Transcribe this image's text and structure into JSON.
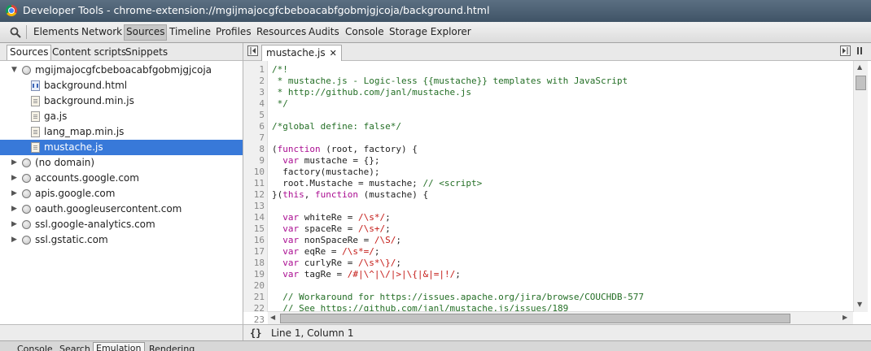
{
  "window": {
    "title": "Developer Tools - chrome-extension://mgijmajocgfcbeboacabfgobmjgjcoja/background.html"
  },
  "toolbar": {
    "tabs": [
      "Elements",
      "Network",
      "Sources",
      "Timeline",
      "Profiles",
      "Resources",
      "Audits",
      "Console",
      "Storage Explorer"
    ],
    "active": "Sources"
  },
  "navigator": {
    "tabs": [
      "Sources",
      "Content scripts",
      "Snippets"
    ],
    "tree": [
      {
        "label": "mgijmajocgfcbeboacabfgobmjgjcoja",
        "type": "origin",
        "expanded": true
      },
      {
        "label": "background.html",
        "type": "html"
      },
      {
        "label": "background.min.js",
        "type": "js"
      },
      {
        "label": "ga.js",
        "type": "js"
      },
      {
        "label": "lang_map.min.js",
        "type": "js"
      },
      {
        "label": "mustache.js",
        "type": "js",
        "selected": true
      },
      {
        "label": "(no domain)",
        "type": "origin"
      },
      {
        "label": "accounts.google.com",
        "type": "origin"
      },
      {
        "label": "apis.google.com",
        "type": "origin"
      },
      {
        "label": "oauth.googleusercontent.com",
        "type": "origin"
      },
      {
        "label": "ssl.google-analytics.com",
        "type": "origin"
      },
      {
        "label": "ssl.gstatic.com",
        "type": "origin"
      }
    ]
  },
  "editor": {
    "file_tab": "mustache.js",
    "close": "✕",
    "lines": [
      [
        {
          "t": "/*!",
          "c": "comment"
        }
      ],
      [
        {
          "t": " * mustache.js - Logic-less {{mustache}} templates with JavaScript",
          "c": "comment"
        }
      ],
      [
        {
          "t": " * http://github.com/janl/mustache.js",
          "c": "comment"
        }
      ],
      [
        {
          "t": " */",
          "c": "comment"
        }
      ],
      [],
      [
        {
          "t": "/*global define: false*/",
          "c": "comment"
        }
      ],
      [],
      [
        {
          "t": "(",
          "c": "plain"
        },
        {
          "t": "function",
          "c": "keyword"
        },
        {
          "t": " (root, factory) {",
          "c": "plain"
        }
      ],
      [
        {
          "t": "  ",
          "c": "plain"
        },
        {
          "t": "var",
          "c": "keyword"
        },
        {
          "t": " mustache = {};",
          "c": "plain"
        }
      ],
      [
        {
          "t": "  factory(mustache);",
          "c": "plain"
        }
      ],
      [
        {
          "t": "  root.Mustache = mustache; ",
          "c": "plain"
        },
        {
          "t": "// <script>",
          "c": "comment"
        }
      ],
      [
        {
          "t": "}(",
          "c": "plain"
        },
        {
          "t": "this",
          "c": "keyword"
        },
        {
          "t": ", ",
          "c": "plain"
        },
        {
          "t": "function",
          "c": "keyword"
        },
        {
          "t": " (mustache) {",
          "c": "plain"
        }
      ],
      [],
      [
        {
          "t": "  ",
          "c": "plain"
        },
        {
          "t": "var",
          "c": "keyword"
        },
        {
          "t": " whiteRe = ",
          "c": "plain"
        },
        {
          "t": "/\\s*/",
          "c": "regex"
        },
        {
          "t": ";",
          "c": "plain"
        }
      ],
      [
        {
          "t": "  ",
          "c": "plain"
        },
        {
          "t": "var",
          "c": "keyword"
        },
        {
          "t": " spaceRe = ",
          "c": "plain"
        },
        {
          "t": "/\\s+/",
          "c": "regex"
        },
        {
          "t": ";",
          "c": "plain"
        }
      ],
      [
        {
          "t": "  ",
          "c": "plain"
        },
        {
          "t": "var",
          "c": "keyword"
        },
        {
          "t": " nonSpaceRe = ",
          "c": "plain"
        },
        {
          "t": "/\\S/",
          "c": "regex"
        },
        {
          "t": ";",
          "c": "plain"
        }
      ],
      [
        {
          "t": "  ",
          "c": "plain"
        },
        {
          "t": "var",
          "c": "keyword"
        },
        {
          "t": " eqRe = ",
          "c": "plain"
        },
        {
          "t": "/\\s*=/",
          "c": "regex"
        },
        {
          "t": ";",
          "c": "plain"
        }
      ],
      [
        {
          "t": "  ",
          "c": "plain"
        },
        {
          "t": "var",
          "c": "keyword"
        },
        {
          "t": " curlyRe = ",
          "c": "plain"
        },
        {
          "t": "/\\s*\\}/",
          "c": "regex"
        },
        {
          "t": ";",
          "c": "plain"
        }
      ],
      [
        {
          "t": "  ",
          "c": "plain"
        },
        {
          "t": "var",
          "c": "keyword"
        },
        {
          "t": " tagRe = ",
          "c": "plain"
        },
        {
          "t": "/#|\\^|\\/|>|\\{|&|=|!/",
          "c": "regex"
        },
        {
          "t": ";",
          "c": "plain"
        }
      ],
      [],
      [
        {
          "t": "  // Workaround for https://issues.apache.org/jira/browse/COUCHDB-577",
          "c": "comment"
        }
      ],
      [
        {
          "t": "  // See https://github.com/janl/mustache.js/issues/189",
          "c": "comment"
        }
      ],
      []
    ]
  },
  "status": {
    "position": "Line 1, Column 1",
    "format_icon": "{}"
  },
  "drawer": {
    "tabs": [
      "Console",
      "Search",
      "Emulation",
      "Rendering"
    ],
    "active": "Emulation"
  },
  "colors": {
    "comment": "#236e25",
    "keyword": "#aa0d91",
    "regex": "#c41a16",
    "plain": "#222222",
    "selection": "#3879d9"
  },
  "icons": {
    "search": "search-icon",
    "origin": "globe-icon",
    "file": "file-icon"
  }
}
